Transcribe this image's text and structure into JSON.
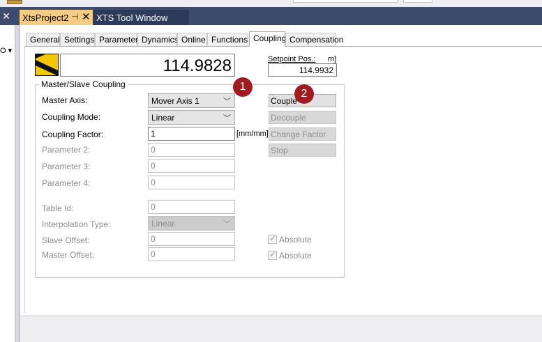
{
  "document_tabs": [
    {
      "label": "XtsProject2",
      "pin": "⊣",
      "close": "✕"
    },
    {
      "label": "XTS Tool Window"
    }
  ],
  "left_panel": {
    "close": "✕",
    "dropdown": "O ▾"
  },
  "property_tabs": [
    "General",
    "Settings",
    "Parameter",
    "Dynamics",
    "Online",
    "Functions",
    "Coupling",
    "Compensation"
  ],
  "active_tab": "Coupling",
  "position_value": "114.9828",
  "setpoint": {
    "label": "Setpoint Pos.:",
    "unit": "m]",
    "value": "114.9932"
  },
  "group_title": "Master/Slave Coupling",
  "rows": {
    "master_axis": {
      "label": "Master Axis:",
      "value": "Mover Axis 1"
    },
    "coupling_mode": {
      "label": "Coupling Mode:",
      "value": "Linear"
    },
    "coupling_factor": {
      "label": "Coupling Factor:",
      "value": "1",
      "unit": "[mm/mm]"
    },
    "parameter2": {
      "label": "Parameter 2:",
      "value": "0"
    },
    "parameter3": {
      "label": "Parameter 3:",
      "value": "0"
    },
    "parameter4": {
      "label": "Parameter 4:",
      "value": "0"
    },
    "table_id": {
      "label": "Table Id:",
      "value": "0"
    },
    "interpolation_type": {
      "label": "Interpolation Type:",
      "value": "Linear"
    },
    "slave_offset": {
      "label": "Slave Offset:",
      "value": "0",
      "check_label": "Absolute",
      "checked": true
    },
    "master_offset": {
      "label": "Master Offset:",
      "value": "0",
      "check_label": "Absolute",
      "checked": true
    }
  },
  "buttons": {
    "couple": "Couple",
    "decouple": "Decouple",
    "change_factor": "Change Factor",
    "stop": "Stop"
  },
  "callouts": [
    "1",
    "2"
  ],
  "colors": {
    "accent_tab": "#f5cc84",
    "dark_band": "#3d4c6e",
    "callout": "#a01c20",
    "indicator_yellow": "#f4c800"
  }
}
